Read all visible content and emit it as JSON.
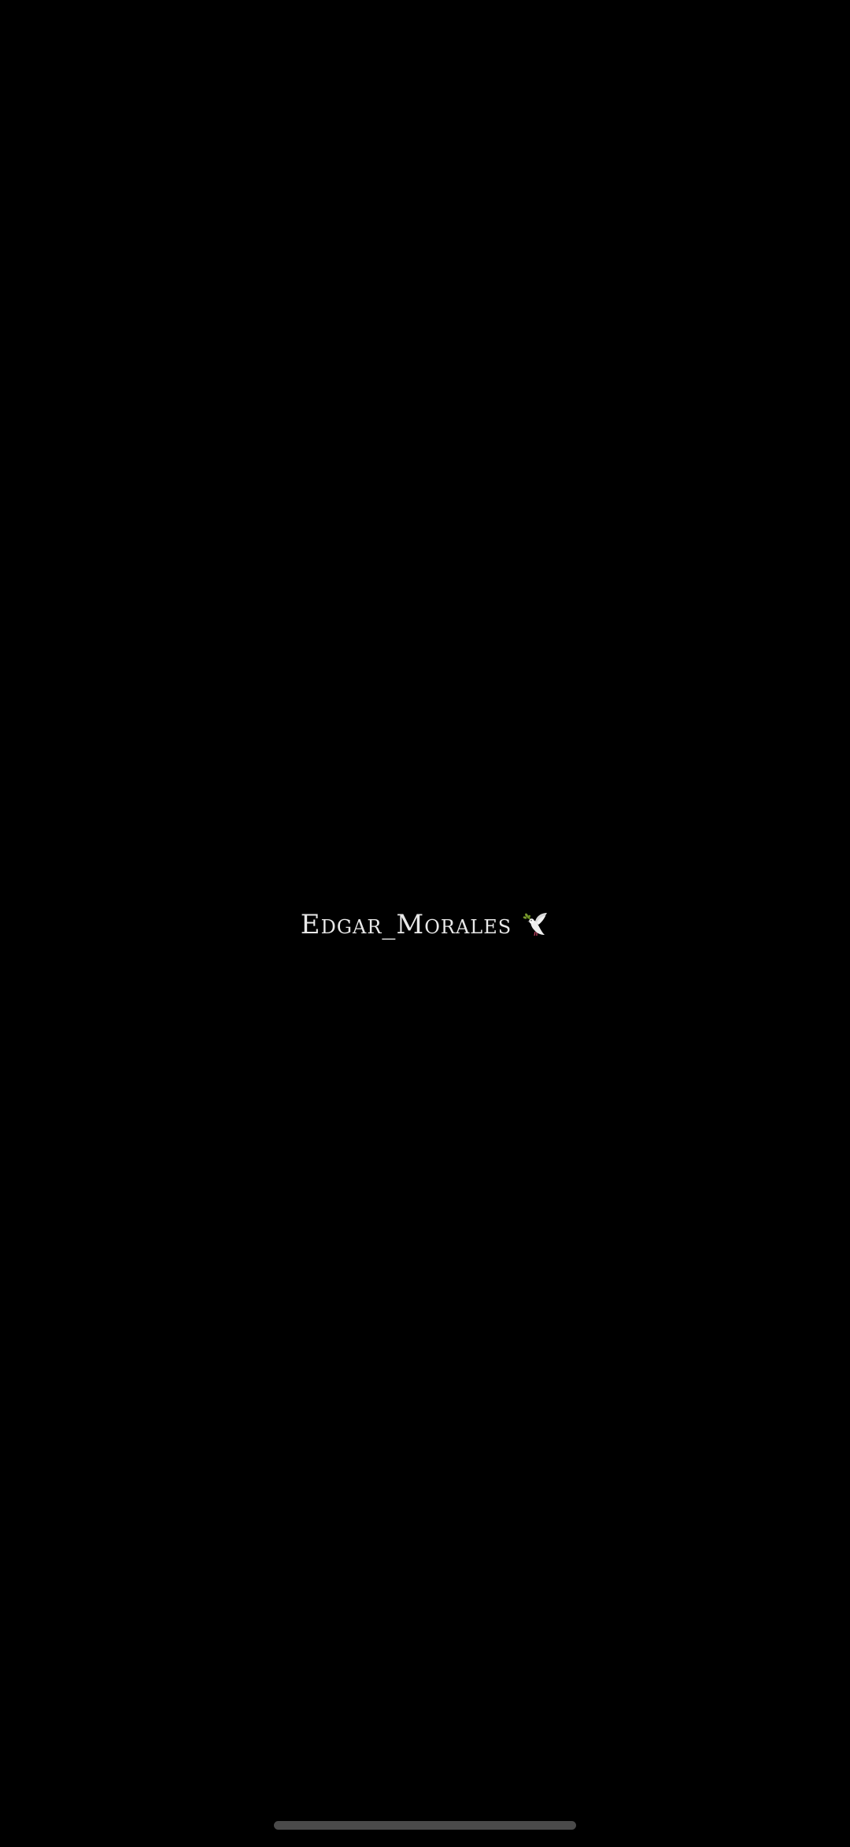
{
  "splash": {
    "username": "Edgar_Morales",
    "emblem_icon": "dove-with-olive-branch-icon"
  },
  "system": {
    "home_indicator_icon": "home-indicator-bar"
  },
  "colors": {
    "background": "#000000",
    "text": "#e8e8e8",
    "home_indicator": "#4a4a4a"
  }
}
